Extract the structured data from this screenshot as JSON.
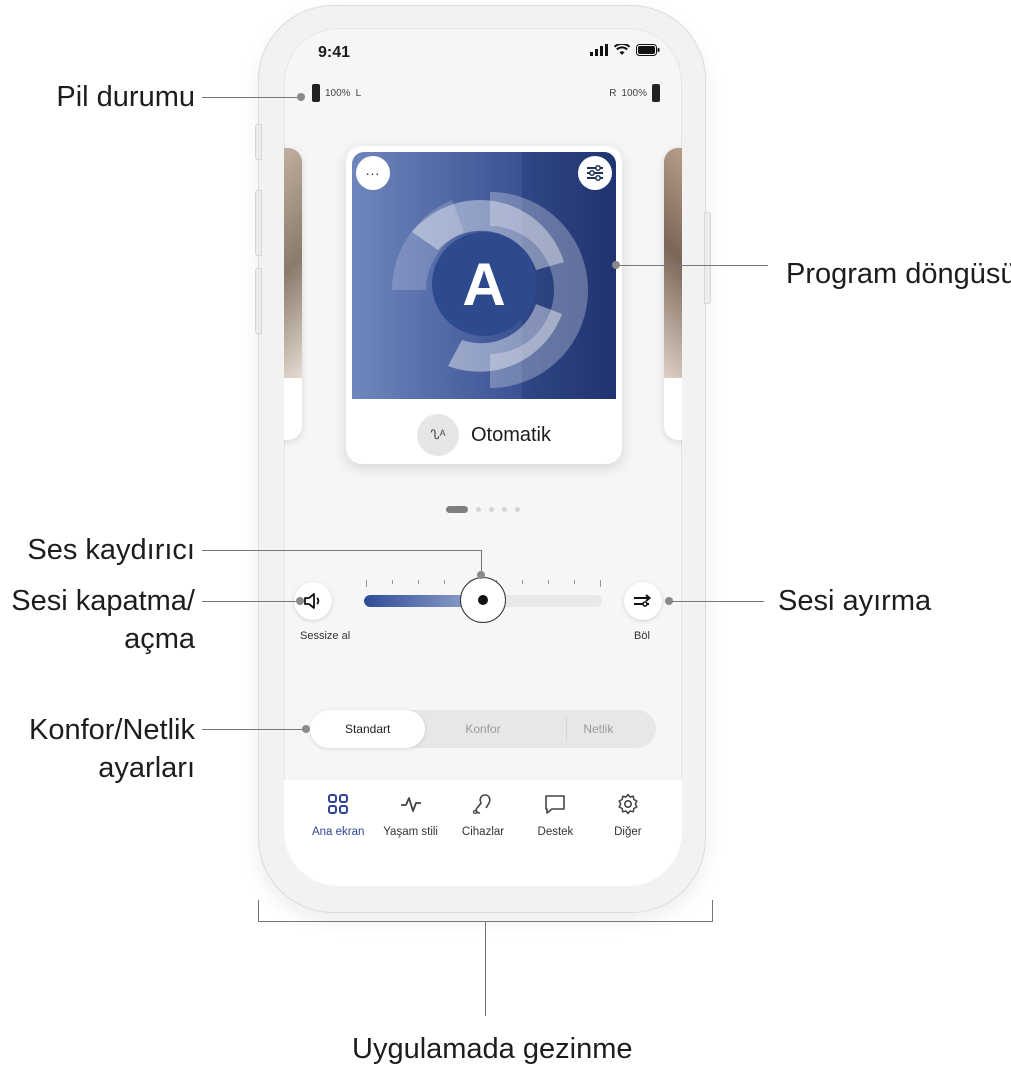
{
  "status_bar": {
    "time": "9:41"
  },
  "battery": {
    "left": {
      "percent": "100%",
      "side": "L"
    },
    "right": {
      "percent": "100%",
      "side": "R"
    }
  },
  "program_card": {
    "letter": "A",
    "name": "Otomatik",
    "more_icon": "ellipsis-icon",
    "settings_icon": "sliders-icon",
    "program_icon": "ear-auto-icon",
    "pager": {
      "count": 5,
      "active_index": 0
    }
  },
  "volume": {
    "mute_label": "Sessize al",
    "split_label": "Böl",
    "level_fraction": 0.5,
    "mute_icon": "speaker-icon",
    "split_icon": "split-arrows-icon"
  },
  "sound_mode": {
    "options": [
      "Standart",
      "Konfor",
      "Netlik"
    ],
    "selected": "Standart"
  },
  "tab_bar": {
    "items": [
      {
        "label": "Ana ekran",
        "icon": "grid-icon",
        "active": true
      },
      {
        "label": "Yaşam stili",
        "icon": "pulse-icon",
        "active": false
      },
      {
        "label": "Cihazlar",
        "icon": "hearing-aid-icon",
        "active": false
      },
      {
        "label": "Destek",
        "icon": "chat-icon",
        "active": false
      },
      {
        "label": "Diğer",
        "icon": "gear-icon",
        "active": false
      }
    ]
  },
  "callouts": {
    "battery_status": "Pil durumu",
    "program_cycle": "Program döngüsü",
    "volume_slider": "Ses kaydırıcı",
    "mute_line1": "Sesi kapatma/",
    "mute_line2": "açma",
    "split_sound": "Sesi ayırma",
    "comfort_line1": "Konfor/Netlik",
    "comfort_line2": "ayarları",
    "app_navigation": "Uygulamada gezinme"
  },
  "colors": {
    "accent": "#2e4596",
    "card_gradient_start": "#6f86bd",
    "card_gradient_end": "#1f3470"
  }
}
